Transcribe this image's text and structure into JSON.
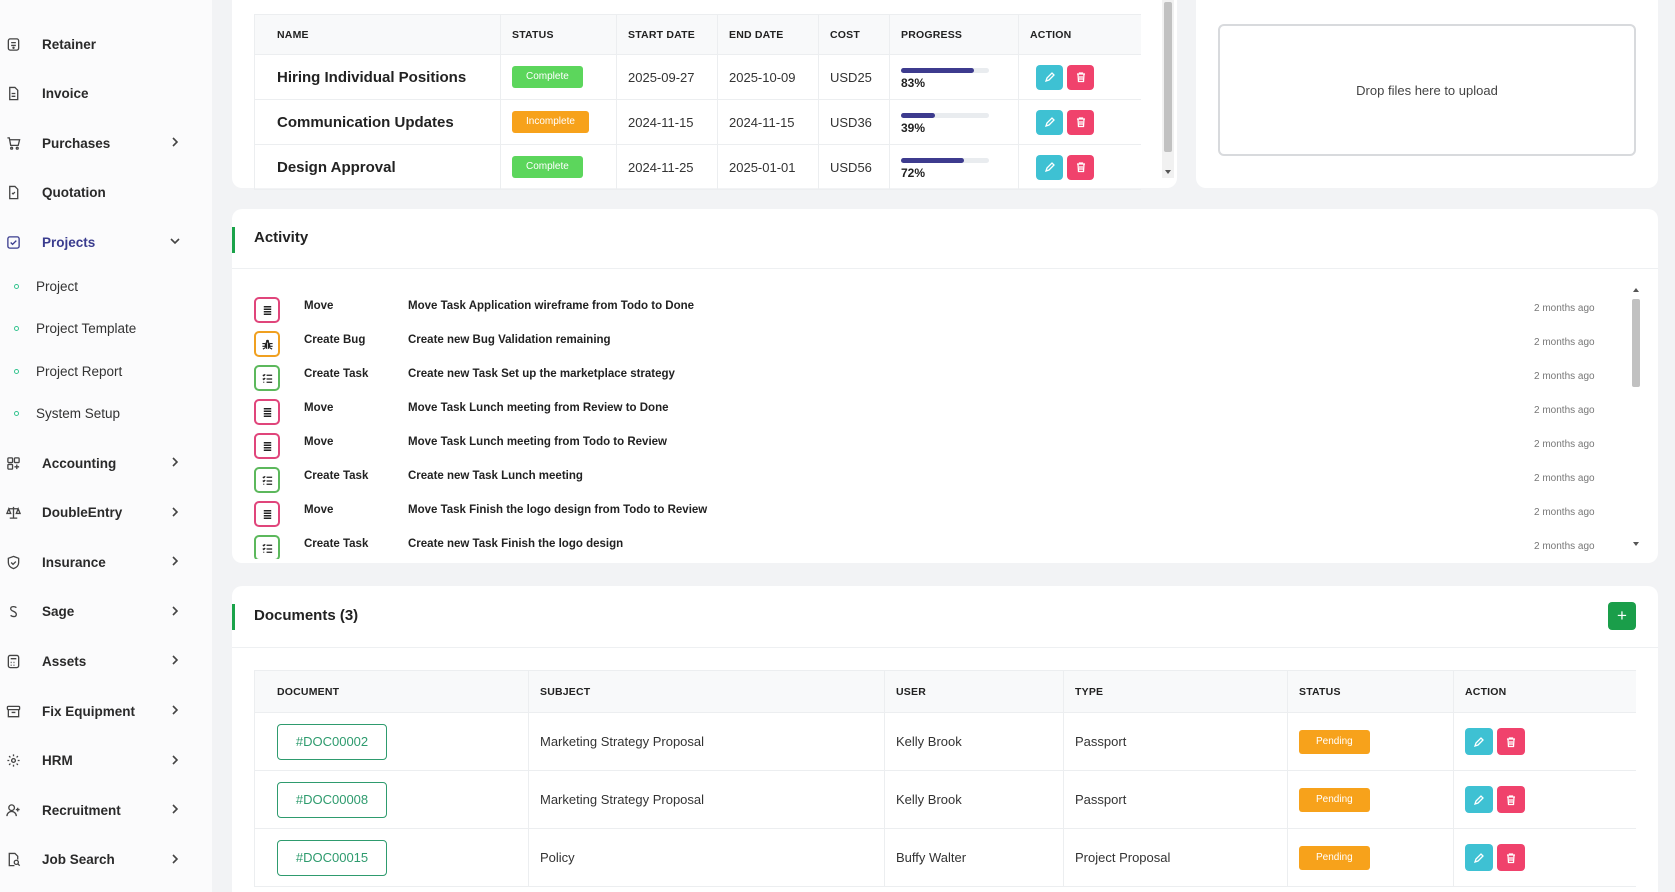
{
  "sidebar": {
    "items": [
      {
        "label": "Retainer",
        "icon": "retainer-icon",
        "chevron": false
      },
      {
        "label": "Invoice",
        "icon": "invoice-icon",
        "chevron": false
      },
      {
        "label": "Purchases",
        "icon": "cart-icon",
        "chevron": true
      },
      {
        "label": "Quotation",
        "icon": "quotation-icon",
        "chevron": false
      },
      {
        "label": "Projects",
        "icon": "check-square-icon",
        "chevron": true,
        "active": true
      }
    ],
    "sub_items": [
      {
        "label": "Project"
      },
      {
        "label": "Project Template"
      },
      {
        "label": "Project Report"
      },
      {
        "label": "System Setup"
      }
    ],
    "items_after": [
      {
        "label": "Accounting",
        "icon": "grid-icon"
      },
      {
        "label": "DoubleEntry",
        "icon": "scale-icon"
      },
      {
        "label": "Insurance",
        "icon": "shield-icon"
      },
      {
        "label": "Sage",
        "icon": "sage-icon"
      },
      {
        "label": "Assets",
        "icon": "calculator-icon"
      },
      {
        "label": "Fix Equipment",
        "icon": "archive-icon"
      },
      {
        "label": "HRM",
        "icon": "hrm-icon"
      },
      {
        "label": "Recruitment",
        "icon": "user-plus-icon"
      },
      {
        "label": "Job Search",
        "icon": "file-search-icon"
      }
    ]
  },
  "milestones": {
    "headers": [
      "NAME",
      "STATUS",
      "START DATE",
      "END DATE",
      "COST",
      "PROGRESS",
      "ACTION"
    ],
    "rows": [
      {
        "name": "Hiring Individual Positions",
        "status": "Complete",
        "start": "2025-09-27",
        "end": "2025-10-09",
        "cost": "USD25",
        "progress": 83,
        "progress_text": "83%"
      },
      {
        "name": "Communication Updates",
        "status": "Incomplete",
        "start": "2024-11-15",
        "end": "2024-11-15",
        "cost": "USD36",
        "progress": 39,
        "progress_text": "39%"
      },
      {
        "name": "Design Approval",
        "status": "Complete",
        "start": "2024-11-25",
        "end": "2025-01-01",
        "cost": "USD56",
        "progress": 72,
        "progress_text": "72%"
      }
    ]
  },
  "upload": {
    "dropzone_text": "Drop files here to upload"
  },
  "activity": {
    "title": "Activity",
    "rows": [
      {
        "type": "Move",
        "desc": "Move Task Application wireframe from Todo to Done",
        "time": "2 months ago",
        "icon": "list-icon",
        "color": "#e0457b"
      },
      {
        "type": "Create Bug",
        "desc": "Create new Bug Validation remaining",
        "time": "2 months ago",
        "icon": "bug-icon",
        "color": "#f0a020"
      },
      {
        "type": "Create Task",
        "desc": "Create new Task Set up the marketplace strategy",
        "time": "2 months ago",
        "icon": "task-list-icon",
        "color": "#5cb85c"
      },
      {
        "type": "Move",
        "desc": "Move Task Lunch meeting from Review to Done",
        "time": "2 months ago",
        "icon": "list-icon",
        "color": "#e0457b"
      },
      {
        "type": "Move",
        "desc": "Move Task Lunch meeting from Todo to Review",
        "time": "2 months ago",
        "icon": "list-icon",
        "color": "#e0457b"
      },
      {
        "type": "Create Task",
        "desc": "Create new Task Lunch meeting",
        "time": "2 months ago",
        "icon": "task-list-icon",
        "color": "#5cb85c"
      },
      {
        "type": "Move",
        "desc": "Move Task Finish the logo design from Todo to Review",
        "time": "2 months ago",
        "icon": "list-icon",
        "color": "#e0457b"
      },
      {
        "type": "Create Task",
        "desc": "Create new Task Finish the logo design",
        "time": "2 months ago",
        "icon": "task-list-icon",
        "color": "#5cb85c"
      }
    ]
  },
  "documents": {
    "title": "Documents (3)",
    "add_label": "+",
    "headers": [
      "DOCUMENT",
      "SUBJECT",
      "USER",
      "TYPE",
      "STATUS",
      "ACTION"
    ],
    "rows": [
      {
        "doc": "#DOC00002",
        "subject": "Marketing Strategy Proposal",
        "user": "Kelly Brook",
        "type": "Passport",
        "status": "Pending"
      },
      {
        "doc": "#DOC00008",
        "subject": "Marketing Strategy Proposal",
        "user": "Kelly Brook",
        "type": "Passport",
        "status": "Pending"
      },
      {
        "doc": "#DOC00015",
        "subject": "Policy",
        "user": "Buffy Walter",
        "type": "Project Proposal",
        "status": "Pending"
      }
    ]
  },
  "colors": {
    "complete": "#5cd65c",
    "incomplete": "#f7a21b",
    "pending": "#f7a21b",
    "edit": "#3ec1d3",
    "delete": "#f0426c",
    "accent_green": "#1aa34a",
    "add_button": "#1a9e4a"
  }
}
